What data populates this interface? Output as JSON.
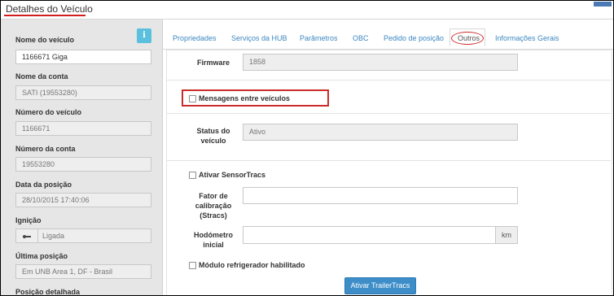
{
  "header": {
    "title": "Detalhes do Veículo"
  },
  "left": {
    "info_glyph": "i",
    "fields": [
      {
        "label": "Nome do veículo",
        "value": "1166671 Giga"
      },
      {
        "label": "Nome da conta",
        "value": "SATI (19553280)"
      },
      {
        "label": "Número do veículo",
        "value": "1166671"
      },
      {
        "label": "Número da conta",
        "value": "19553280"
      },
      {
        "label": "Data da posição",
        "value": "28/10/2015 17:40:06"
      },
      {
        "label": "Ignição",
        "value": "Ligada"
      },
      {
        "label": "Última posição",
        "value": "Em  UNB Area 1, DF - Brasil"
      },
      {
        "label": "Posição detalhada",
        "value": ""
      }
    ]
  },
  "tabs": [
    {
      "label": "Propriedades"
    },
    {
      "label": "Serviços da HUB"
    },
    {
      "label": "Parâmetros"
    },
    {
      "label": "OBC"
    },
    {
      "label": "Pedido de posição"
    },
    {
      "label": "Outros",
      "active": true
    },
    {
      "label": "Informações Gerais"
    }
  ],
  "form": {
    "firmware_label": "Firmware",
    "firmware_value": "1858",
    "mensagens_label": "Mensagens entre veículos",
    "status_label_1": "Status do",
    "status_label_2": "veículo",
    "status_value": "Ativo",
    "sensortracs_label": "Ativar SensorTracs",
    "fator_label_1": "Fator de",
    "fator_label_2": "calibração",
    "fator_label_3": "(Stracs)",
    "fator_value": "",
    "hodometro_label_1": "Hodómetro",
    "hodometro_label_2": "inicial",
    "hodometro_value": "",
    "hodometro_unit": "km",
    "refrigerador_label": "Módulo refrigerador habilitado",
    "trailer_button": "Ativar TrailerTracs"
  },
  "colors": {
    "accent_red": "#cc2b2b",
    "link_blue": "#3c87c0",
    "info_blue": "#5bc0de",
    "button_blue": "#3c8dc8"
  }
}
